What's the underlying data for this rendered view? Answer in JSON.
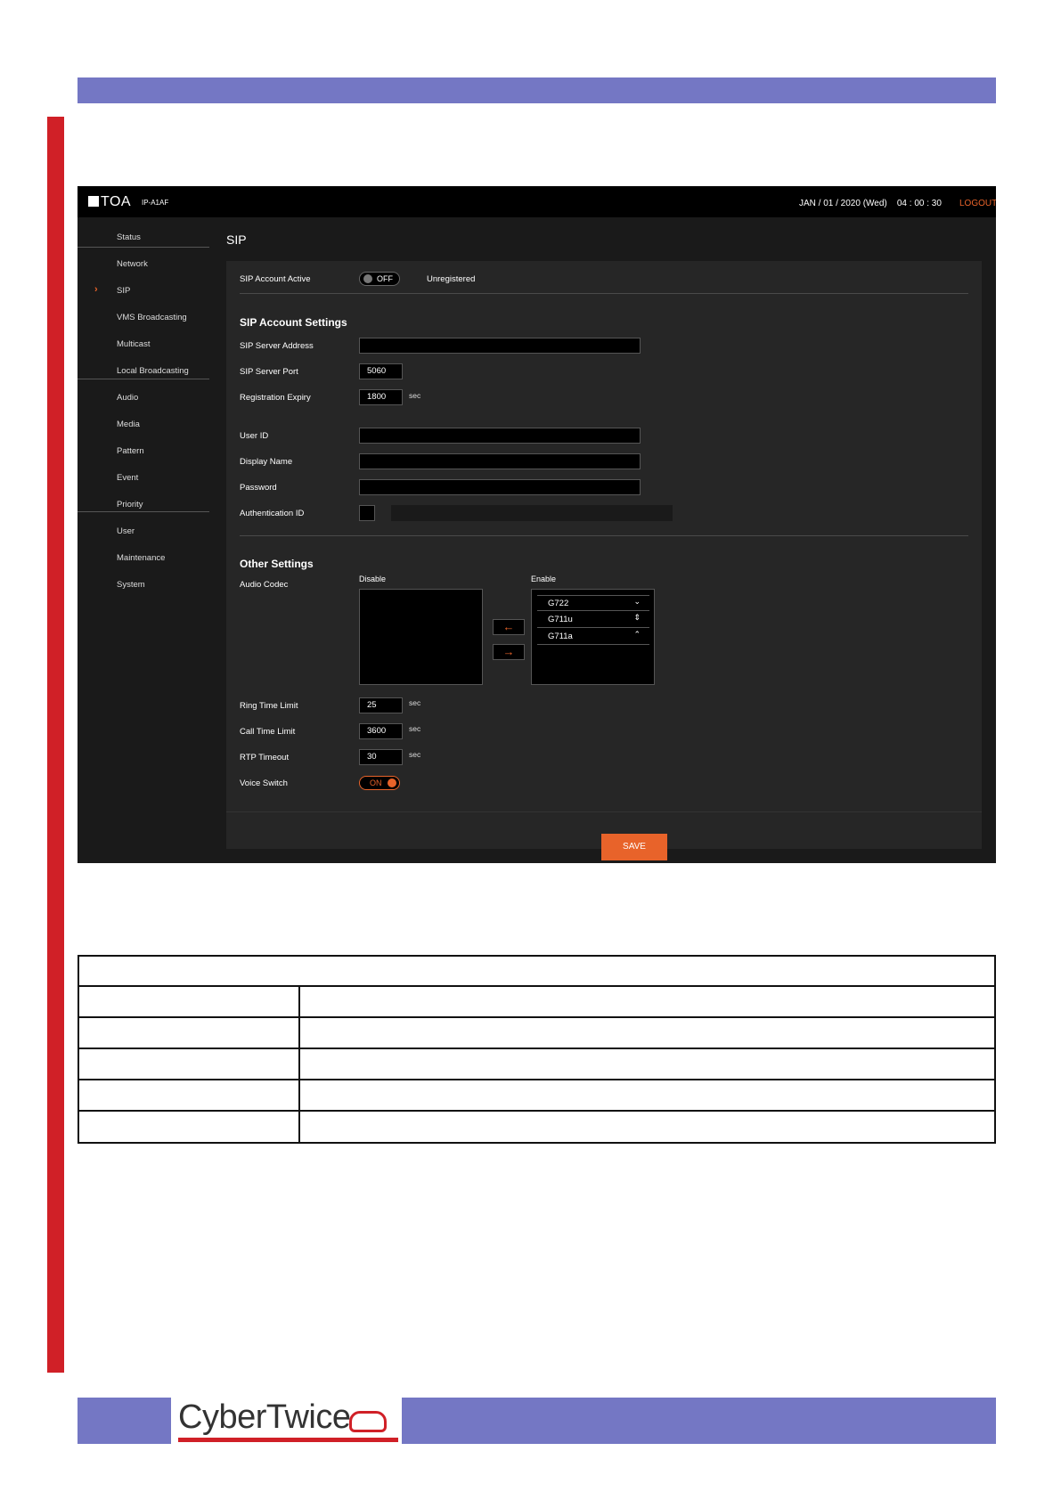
{
  "header": {
    "brand": "TOA",
    "model": "IP-A1AF",
    "datetime": "JAN / 01 / 2020 (Wed)    04 : 00 : 30",
    "logout": "LOGOUT"
  },
  "nav": {
    "items": [
      "Status",
      "Network",
      "SIP",
      "VMS Broadcasting",
      "Multicast",
      "Local Broadcasting",
      "Audio",
      "Media",
      "Pattern",
      "Event",
      "Priority",
      "User",
      "Maintenance",
      "System"
    ],
    "active": "SIP"
  },
  "page": {
    "title": "SIP",
    "account_active_label": "SIP Account Active",
    "account_active_toggle": "OFF",
    "registration_status": "Unregistered",
    "account_section": "SIP Account Settings",
    "server_address_label": "SIP Server Address",
    "server_address_value": "",
    "server_port_label": "SIP Server Port",
    "server_port_value": "5060",
    "expiry_label": "Registration Expiry",
    "expiry_value": "1800",
    "sec": "sec",
    "user_id_label": "User ID",
    "display_name_label": "Display Name",
    "password_label": "Password",
    "auth_id_label": "Authentication ID",
    "other_section": "Other Settings",
    "audio_codec_label": "Audio Codec",
    "disable_label": "Disable",
    "enable_label": "Enable",
    "arrow_left": "←",
    "arrow_right": "→",
    "enabled_codecs": [
      "G722",
      "G711u",
      "G711a"
    ],
    "ring_label": "Ring Time Limit",
    "ring_value": "25",
    "call_label": "Call Time Limit",
    "call_value": "3600",
    "rtp_label": "RTP Timeout",
    "rtp_value": "30",
    "voice_label": "Voice Switch",
    "voice_toggle": "ON",
    "save": "SAVE"
  },
  "footer": {
    "brand": "CyberTwice"
  },
  "colors": {
    "accent": "#e8632a",
    "band": "#7477c4",
    "red": "#d02027"
  }
}
